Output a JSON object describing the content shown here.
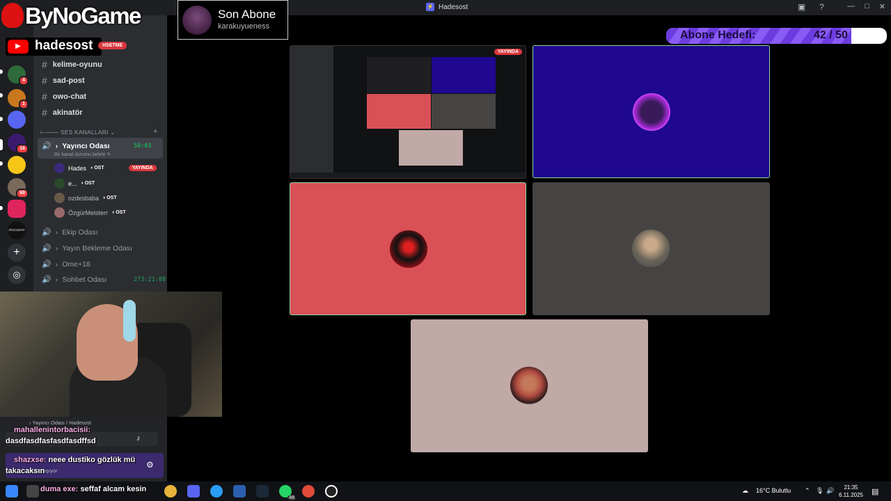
{
  "window": {
    "title": "Hadesost"
  },
  "overlay": {
    "logo": "ByNoGame",
    "youtube_name": "hadesost",
    "youtube_tag": "HSETME",
    "last_sub_title": "Son Abone",
    "last_sub_name": "karakuyueness",
    "goal_label": "Abone Hedefi:",
    "goal_count": "42 / 50",
    "goal_current": 42,
    "goal_target": 50
  },
  "sidebar": {
    "server_header": "Hadesost",
    "text_channels": [
      "kelime-oyunu",
      "sad-post",
      "owo-chat",
      "akinatör"
    ],
    "voice_category": "SES KANALLARI",
    "active_voice": {
      "name": "Yayıncı Odası",
      "time": "50:03",
      "status": "Bir kanal durumu belirle"
    },
    "members": [
      {
        "name": "Hades",
        "role": "OST",
        "live": "YAYINDA"
      },
      {
        "name": "e...",
        "role": "OST"
      },
      {
        "name": "ozdesbaba",
        "role": "OST"
      },
      {
        "name": "ÖzgürMeisterr",
        "role": "OST"
      }
    ],
    "voice_channels": [
      {
        "name": "Ekip Odası",
        "time": ""
      },
      {
        "name": "Yayın Bekleme Odası",
        "time": ""
      },
      {
        "name": "Ome+18",
        "time": ""
      },
      {
        "name": "Sohbet Odası",
        "time": "273:21:08"
      }
    ],
    "server_badges": [
      "4",
      "1",
      "16",
      "68"
    ],
    "server_label": "okocaamo"
  },
  "stage": {
    "screen_tag": "YAYINDA"
  },
  "chat": {
    "breadcrumb": "Yayıncı Odası / Hadesost",
    "messages": [
      {
        "user": "mahallenintorbacisii:",
        "text": "dasdfasdfasfasdfasdffsd"
      },
      {
        "user": "shazxse:",
        "text": "neee dustiko gözlük mü"
      },
      {
        "user": "",
        "text": "takacaksın"
      },
      {
        "user": "duma exe:",
        "text": "seffaf alcam kesin"
      }
    ],
    "sharing_hint": "nu paylaşıyor"
  },
  "taskbar": {
    "weather": "16°C  Bulutlu",
    "time": "21:35",
    "date": "6.11.2025",
    "whatsapp_badge": "48"
  },
  "colors": {
    "accent_purple": "#6c3ce0",
    "live_red": "#da373c",
    "online_green": "#23a55a"
  }
}
